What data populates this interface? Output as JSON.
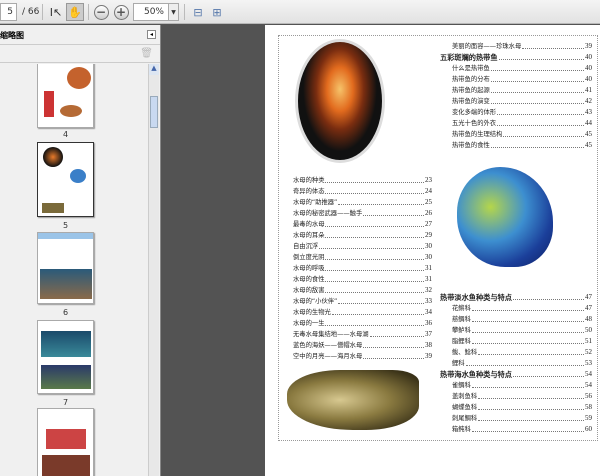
{
  "toolbar": {
    "page_current": "5",
    "page_total": "/ 66",
    "zoom": "50%",
    "icons": [
      "select-tool-icon",
      "hand-tool-icon",
      "zoom-out-icon",
      "zoom-in-icon",
      "fit-width-icon",
      "fit-page-icon"
    ]
  },
  "panel": {
    "title": "缩略图",
    "thumbnails": [
      {
        "label": "4"
      },
      {
        "label": "5"
      },
      {
        "label": "6"
      },
      {
        "label": "7"
      }
    ]
  },
  "toc_left": [
    {
      "t": "水母的种类",
      "n": "23"
    },
    {
      "t": "奇异的体态",
      "n": "24"
    },
    {
      "t": "水母的“助推器”",
      "n": "25"
    },
    {
      "t": "水母的秘密武器——触手",
      "n": "26"
    },
    {
      "t": "最毒的水母",
      "n": "27"
    },
    {
      "t": "水母的耳朵",
      "n": "29"
    },
    {
      "t": "自由沉浮",
      "n": "30"
    },
    {
      "t": "倒立度光阴",
      "n": "30"
    },
    {
      "t": "水母的呼吸",
      "n": "31"
    },
    {
      "t": "水母的食性",
      "n": "31"
    },
    {
      "t": "水母的敌害",
      "n": "32"
    },
    {
      "t": "水母的“小伙伴”",
      "n": "33"
    },
    {
      "t": "水母的生物光",
      "n": "34"
    },
    {
      "t": "水母的一生",
      "n": "36"
    },
    {
      "t": "无毒水母集结地——水母湖",
      "n": "37"
    },
    {
      "t": "蓝色的海妖——僧帽水母",
      "n": "38"
    },
    {
      "t": "空中的月亮——海月水母",
      "n": "39"
    }
  ],
  "toc_right_top": [
    {
      "t": "美丽的面容——珍珠水母",
      "n": "39",
      "sub": true
    },
    {
      "t": "五彩斑斓的热带鱼",
      "n": "40",
      "sec": true
    },
    {
      "t": "什么是热带鱼",
      "n": "40",
      "sub": true
    },
    {
      "t": "热带鱼的分布",
      "n": "40",
      "sub": true
    },
    {
      "t": "热带鱼的起源",
      "n": "41",
      "sub": true
    },
    {
      "t": "热带鱼的演变",
      "n": "42",
      "sub": true
    },
    {
      "t": "变化多端的体形",
      "n": "43",
      "sub": true
    },
    {
      "t": "五光十色的外衣",
      "n": "44",
      "sub": true
    },
    {
      "t": "热带鱼的生理结构",
      "n": "45",
      "sub": true
    },
    {
      "t": "热带鱼的食性",
      "n": "45",
      "sub": true
    }
  ],
  "toc_right_bottom": [
    {
      "t": "热带淡水鱼种类与特点",
      "n": "47",
      "sec": true
    },
    {
      "t": "花鳉科",
      "n": "47",
      "sub": true
    },
    {
      "t": "慈鲷科",
      "n": "48",
      "sub": true
    },
    {
      "t": "攀鲈科",
      "n": "50",
      "sub": true
    },
    {
      "t": "脂鲤科",
      "n": "51",
      "sub": true
    },
    {
      "t": "鲅、鲶科",
      "n": "52",
      "sub": true
    },
    {
      "t": "鲤科",
      "n": "53",
      "sub": true
    },
    {
      "t": "热带海水鱼种类与特点",
      "n": "54",
      "sec": true
    },
    {
      "t": "雀鲷科",
      "n": "54",
      "sub": true
    },
    {
      "t": "盖刺鱼科",
      "n": "56",
      "sub": true
    },
    {
      "t": "蝴蝶鱼科",
      "n": "58",
      "sub": true
    },
    {
      "t": "刺尾鲷科",
      "n": "59",
      "sub": true
    },
    {
      "t": "箱鲀科",
      "n": "60",
      "sub": true
    }
  ]
}
